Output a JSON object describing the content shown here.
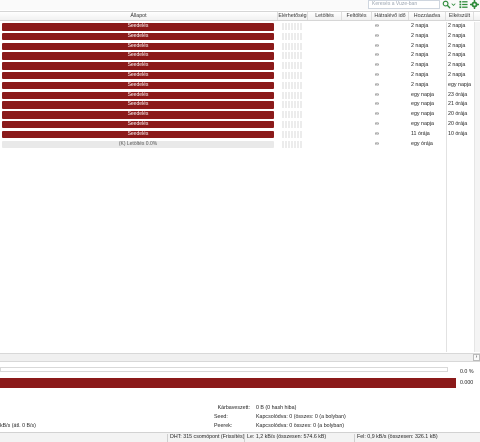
{
  "toolbar": {
    "search_placeholder": "Keresés a Vuze-ban",
    "icons": [
      "search-icon",
      "list-view-icon",
      "settings-icon"
    ]
  },
  "columns": {
    "status": "Állapot",
    "availability": "Elérhetőség",
    "download": "Letöltés",
    "upload": "Feltöltés",
    "eta": "Hátralévő idő",
    "added": "Hozzáadva",
    "completed": "Elkészült"
  },
  "rows": [
    {
      "status": "Seedelés",
      "eta": "∞",
      "added": "2 napja",
      "completed": "2 napja"
    },
    {
      "status": "Seedelés",
      "eta": "∞",
      "added": "2 napja",
      "completed": "2 napja"
    },
    {
      "status": "Seedelés",
      "eta": "∞",
      "added": "2 napja",
      "completed": "2 napja"
    },
    {
      "status": "Seedelés",
      "eta": "∞",
      "added": "2 napja",
      "completed": "2 napja"
    },
    {
      "status": "Seedelés",
      "eta": "∞",
      "added": "2 napja",
      "completed": "2 napja"
    },
    {
      "status": "Seedelés",
      "eta": "∞",
      "added": "2 napja",
      "completed": "2 napja"
    },
    {
      "status": "Seedelés",
      "eta": "∞",
      "added": "2 napja",
      "completed": "egy napja"
    },
    {
      "status": "Seedelés",
      "eta": "∞",
      "added": "egy napja",
      "completed": "23 órája"
    },
    {
      "status": "Seedelés",
      "eta": "∞",
      "added": "egy napja",
      "completed": "21 órája"
    },
    {
      "status": "Seedelés",
      "eta": "∞",
      "added": "egy napja",
      "completed": "20 órája"
    },
    {
      "status": "Seedelés",
      "eta": "∞",
      "added": "egy napja",
      "completed": "20 órája"
    },
    {
      "status": "Seedelés",
      "eta": "∞",
      "added": "11 órája",
      "completed": "10 órája"
    },
    {
      "status": "(K) Letöltés 0.0%",
      "eta": "∞",
      "added": "egy órája",
      "completed": ""
    }
  ],
  "progress": {
    "percent_label": "0.0 %",
    "ratio_label": "0.000"
  },
  "info": {
    "wasted_label": "Kárbaveszett:",
    "wasted_value": "0 B (0 hash hiba)",
    "seeds_label": "Seed:",
    "seeds_value": "Kapcsolódva: 0 (összes: 0 (a bolyban)",
    "peers_label": "Peerek:",
    "peers_value": "Kapcsolódva: 0 összes: 0 (a bolyban)",
    "speed_left": "kB/s (átl. 0 B/s)"
  },
  "statusbar": {
    "dht": "DHT: 315 csomópont (Frissítés)",
    "down": "Le: 1,2 kB/s (összesen: 574.6 kB)",
    "up": "Fel: 0,9 kB/s (összesen: 326.1 kB)"
  },
  "colors": {
    "seeding_bar": "#8b1a1a",
    "toolbar_icon": "#2e8b3a"
  }
}
